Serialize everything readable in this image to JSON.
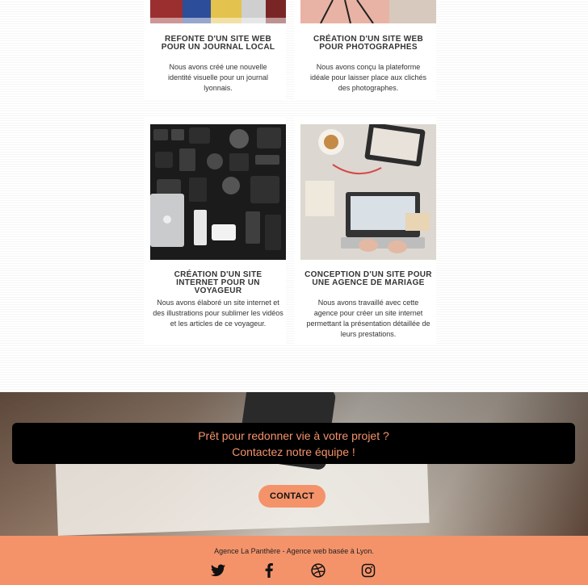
{
  "portfolio": {
    "cards": [
      {
        "title": "REFONTE D'UN SITE WEB POUR UN JOURNAL LOCAL",
        "description": "Nous avons créé une nouvelle identité visuelle pour un journal lyonnais.",
        "image_icon": "magazines-image"
      },
      {
        "title": "CRÉATION D'UN SITE WEB POUR PHOTOGRAPHES",
        "description": "Nous avons conçu la plateforme idéale pour laisser place aux clichés des photographes.",
        "image_icon": "tripod-image"
      },
      {
        "title": "CRÉATION D'UN SITE INTERNET POUR UN VOYAGEUR",
        "description": "Nous avons élaboré un site internet et des illustrations pour sublimer les vidéos et les articles de ce voyageur.",
        "image_icon": "travel-gear-image"
      },
      {
        "title": "CONCEPTION D'UN SITE POUR UNE AGENCE DE MARIAGE",
        "description": "Nous avons travaillé avec cette agence pour créer un site internet permettant la présentation détaillée de leurs prestations.",
        "image_icon": "laptop-desk-image"
      }
    ]
  },
  "cta": {
    "line1": "Prêt pour redonner vie à votre projet ?",
    "line2": "Contactez notre équipe !",
    "button_label": "CONTACT"
  },
  "footer": {
    "tagline": "Agence La Panthère - Agence web basée à Lyon.",
    "social": [
      "twitter-icon",
      "facebook-icon",
      "dribbble-icon",
      "instagram-icon"
    ]
  },
  "colors": {
    "accent": "#f4936a",
    "cta_box": "#000000",
    "text_dark": "#333333"
  }
}
